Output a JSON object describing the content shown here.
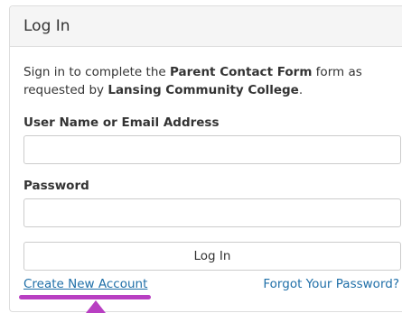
{
  "panel": {
    "title": "Log In"
  },
  "intro": {
    "prefix": "Sign in to complete the ",
    "form_name": "Parent Contact Form",
    "middle": " form as requested by ",
    "organization": "Lansing Community College",
    "suffix": "."
  },
  "fields": {
    "username_label": "User Name or Email Address",
    "username_value": "",
    "password_label": "Password",
    "password_value": ""
  },
  "buttons": {
    "login_label": "Log In"
  },
  "links": {
    "create_account": "Create New Account",
    "forgot_password": "Forgot Your Password?"
  },
  "colors": {
    "link": "#1f6fa8",
    "highlight": "#b83fc2",
    "header_bg": "#f5f5f5",
    "border": "#dddddd"
  }
}
